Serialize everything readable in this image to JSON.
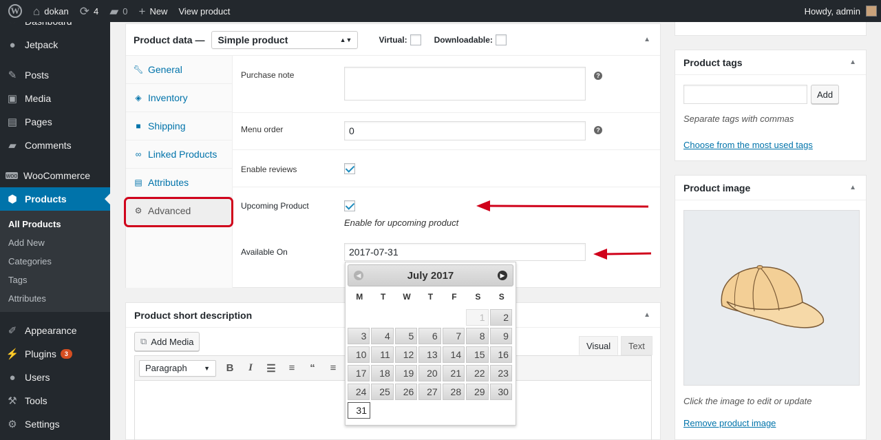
{
  "adminbar": {
    "site_name": "dokan",
    "updates_count": "4",
    "comments_count": "0",
    "new_label": "New",
    "view_product": "View product",
    "howdy": "Howdy, admin"
  },
  "sidebar": {
    "items": [
      {
        "label": "Dashboard",
        "icon": "dashboard-icon"
      },
      {
        "label": "Jetpack",
        "icon": "jetpack-icon"
      },
      {
        "label": "Posts",
        "icon": "pin-icon"
      },
      {
        "label": "Media",
        "icon": "media-icon"
      },
      {
        "label": "Pages",
        "icon": "page-icon"
      },
      {
        "label": "Comments",
        "icon": "comment-icon"
      },
      {
        "label": "WooCommerce",
        "icon": "woo-icon"
      },
      {
        "label": "Products",
        "icon": "products-icon"
      },
      {
        "label": "Appearance",
        "icon": "brush-icon"
      },
      {
        "label": "Plugins",
        "icon": "plug-icon",
        "badge": "3"
      },
      {
        "label": "Users",
        "icon": "user-icon"
      },
      {
        "label": "Tools",
        "icon": "wrench-icon"
      },
      {
        "label": "Settings",
        "icon": "settings-icon"
      }
    ],
    "products_submenu": [
      "All Products",
      "Add New",
      "Categories",
      "Tags",
      "Attributes"
    ]
  },
  "product_data": {
    "title": "Product data —",
    "type_value": "Simple product",
    "virtual_label": "Virtual:",
    "downloadable_label": "Downloadable:",
    "tabs": [
      "General",
      "Inventory",
      "Shipping",
      "Linked Products",
      "Attributes",
      "Advanced"
    ],
    "active_tab": "Advanced",
    "fields": {
      "purchase_note_label": "Purchase note",
      "purchase_note_value": "",
      "menu_order_label": "Menu order",
      "menu_order_value": "0",
      "enable_reviews_label": "Enable reviews",
      "enable_reviews_checked": true,
      "upcoming_label": "Upcoming Product",
      "upcoming_checked": true,
      "upcoming_desc": "Enable for upcoming product",
      "available_on_label": "Available On",
      "available_on_value": "2017-07-31"
    }
  },
  "datepicker": {
    "title": "July 2017",
    "prev_icon": "prev-arrow-icon",
    "next_icon": "next-arrow-icon",
    "weekdays": [
      "M",
      "T",
      "W",
      "T",
      "F",
      "S",
      "S"
    ],
    "weeks": [
      [
        "",
        "",
        "",
        "",
        "",
        "1",
        "2"
      ],
      [
        "3",
        "4",
        "5",
        "6",
        "7",
        "8",
        "9"
      ],
      [
        "10",
        "11",
        "12",
        "13",
        "14",
        "15",
        "16"
      ],
      [
        "17",
        "18",
        "19",
        "20",
        "21",
        "22",
        "23"
      ],
      [
        "24",
        "25",
        "26",
        "27",
        "28",
        "29",
        "30"
      ],
      [
        "31"
      ]
    ],
    "selected": "31",
    "disabled": [
      "1"
    ]
  },
  "short_description": {
    "title": "Product short description",
    "add_media": "Add Media",
    "tab_visual": "Visual",
    "tab_text": "Text",
    "format_value": "Paragraph"
  },
  "product_tags": {
    "title": "Product tags",
    "input_value": "",
    "add_button": "Add",
    "hint": "Separate tags with commas",
    "link": "Choose from the most used tags"
  },
  "product_image": {
    "title": "Product image",
    "hint": "Click the image to edit or update",
    "remove_link": "Remove product image"
  },
  "colors": {
    "admin_bg": "#23282d",
    "accent": "#0073aa",
    "annotation_red": "#d0021b"
  }
}
